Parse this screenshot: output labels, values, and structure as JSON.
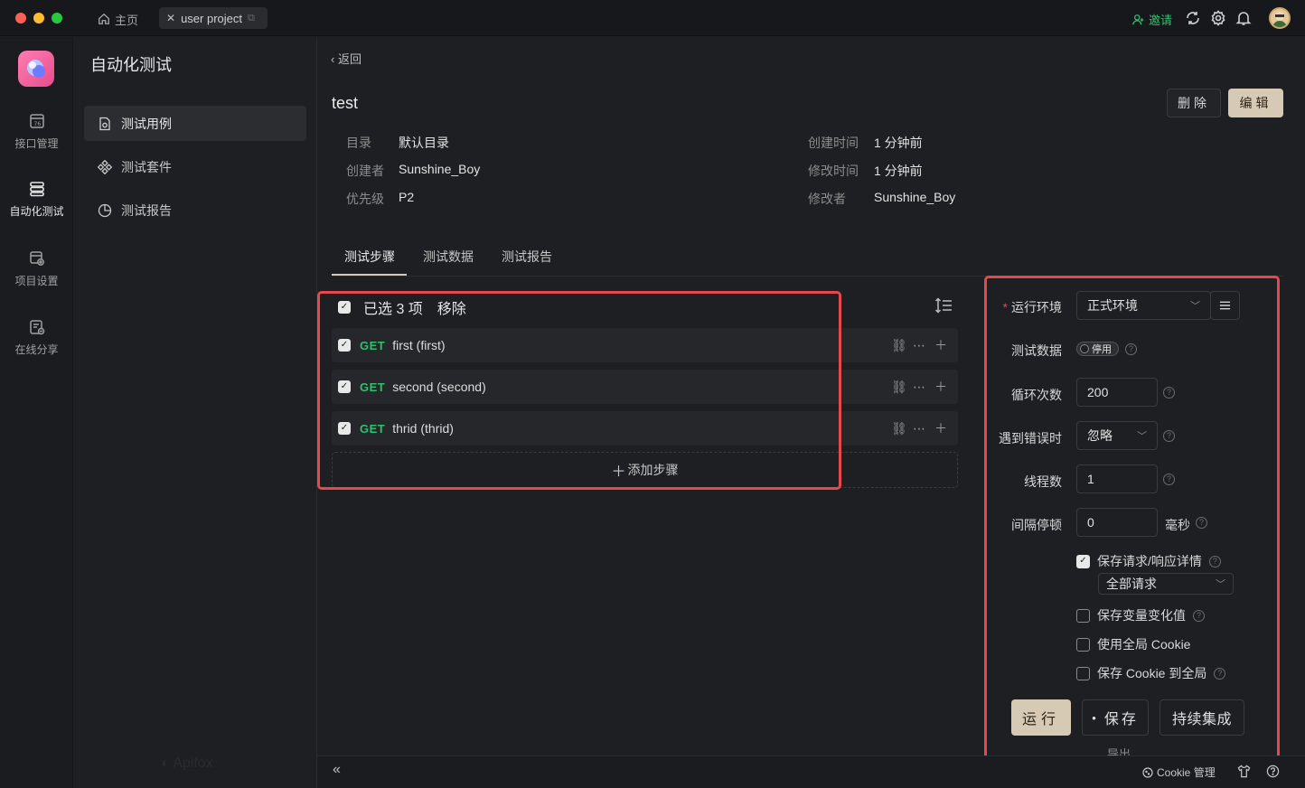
{
  "titlebar": {
    "home_label": "主页",
    "project_tab": "user project",
    "invite": "邀请"
  },
  "sidebar": {
    "items": [
      {
        "label": "接口管理",
        "icon": "api-icon"
      },
      {
        "label": "自动化测试",
        "icon": "automation-icon"
      },
      {
        "label": "项目设置",
        "icon": "project-settings-icon"
      },
      {
        "label": "在线分享",
        "icon": "share-icon"
      }
    ]
  },
  "nav": {
    "title": "自动化测试",
    "items": [
      {
        "label": "测试用例",
        "icon": "test-case-icon"
      },
      {
        "label": "测试套件",
        "icon": "test-suite-icon"
      },
      {
        "label": "测试报告",
        "icon": "test-report-icon"
      }
    ]
  },
  "main": {
    "back": "返回",
    "title": "test",
    "delete_label": "删除",
    "edit_label": "编辑",
    "meta": {
      "dir_label": "目录",
      "dir_value": "默认目录",
      "creator_label": "创建者",
      "creator_value": "Sunshine_Boy",
      "priority_label": "优先级",
      "priority_value": "P2",
      "created_label": "创建时间",
      "created_value": "1 分钟前",
      "modified_label": "修改时间",
      "modified_value": "1 分钟前",
      "modifier_label": "修改者",
      "modifier_value": "Sunshine_Boy"
    },
    "tabs": [
      "测试步骤",
      "测试数据",
      "测试报告"
    ],
    "selection": {
      "text": "已选 3 项",
      "remove": "移除"
    },
    "steps": [
      {
        "method": "GET",
        "name": "first (first)"
      },
      {
        "method": "GET",
        "name": "second (second)"
      },
      {
        "method": "GET",
        "name": "thrid (thrid)"
      }
    ],
    "add_step": "添加步骤"
  },
  "run_panel": {
    "env_label": "运行环境",
    "env_value": "正式环境",
    "test_data_label": "测试数据",
    "test_data_switch": "停用",
    "loop_label": "循环次数",
    "loop_value": "200",
    "error_label": "遇到错误时",
    "error_value": "忽略",
    "threads_label": "线程数",
    "threads_value": "1",
    "interval_label": "间隔停顿",
    "interval_value": "0",
    "interval_unit": "毫秒",
    "save_detail": "保存请求/响应详情",
    "save_detail_select": "全部请求",
    "save_var": "保存变量变化值",
    "use_cookie": "使用全局 Cookie",
    "save_cookie": "保存 Cookie 到全局",
    "run_btn": "运行",
    "save_btn": "保存",
    "ci_btn": "持续集成",
    "export_cut": "导出"
  },
  "bottombar": {
    "cookie_mgr": "Cookie 管理"
  },
  "colors": {
    "accent": "#d7cab4",
    "get_method": "#2fbf71",
    "highlight": "#e5484d",
    "background": "#1e1f22"
  }
}
